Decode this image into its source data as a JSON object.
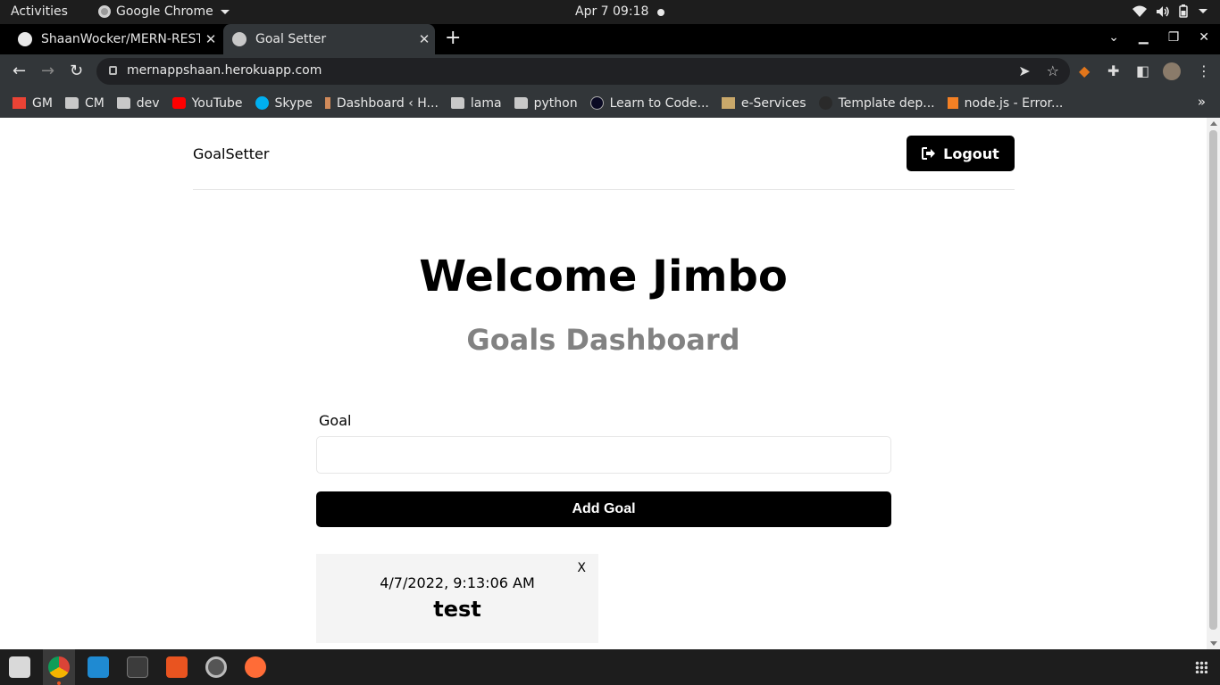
{
  "system_bar": {
    "activities": "Activities",
    "app_name": "Google Chrome",
    "clock": "Apr 7  09:18"
  },
  "browser": {
    "tabs": [
      {
        "title": "ShaanWocker/MERN-REST"
      },
      {
        "title": "Goal Setter"
      }
    ],
    "url": "mernappshaan.herokuapp.com",
    "bookmarks": [
      {
        "label": "GM"
      },
      {
        "label": "CM"
      },
      {
        "label": "dev"
      },
      {
        "label": "YouTube"
      },
      {
        "label": "Skype"
      },
      {
        "label": "Dashboard ‹ H..."
      },
      {
        "label": "lama"
      },
      {
        "label": "python"
      },
      {
        "label": "Learn to Code..."
      },
      {
        "label": "e-Services"
      },
      {
        "label": "Template dep..."
      },
      {
        "label": "node.js - Error..."
      }
    ]
  },
  "page": {
    "logo": "GoalSetter",
    "logout_label": "Logout",
    "welcome": "Welcome Jimbo",
    "subtitle": "Goals Dashboard",
    "form": {
      "goal_label": "Goal",
      "goal_value": "",
      "submit_label": "Add Goal"
    },
    "goals": [
      {
        "date": "4/7/2022, 9:13:06 AM",
        "text": "test",
        "delete_label": "X"
      }
    ]
  },
  "colors": {
    "primary": "#000000",
    "subtitle": "#828282",
    "card_bg": "#f4f4f4"
  }
}
